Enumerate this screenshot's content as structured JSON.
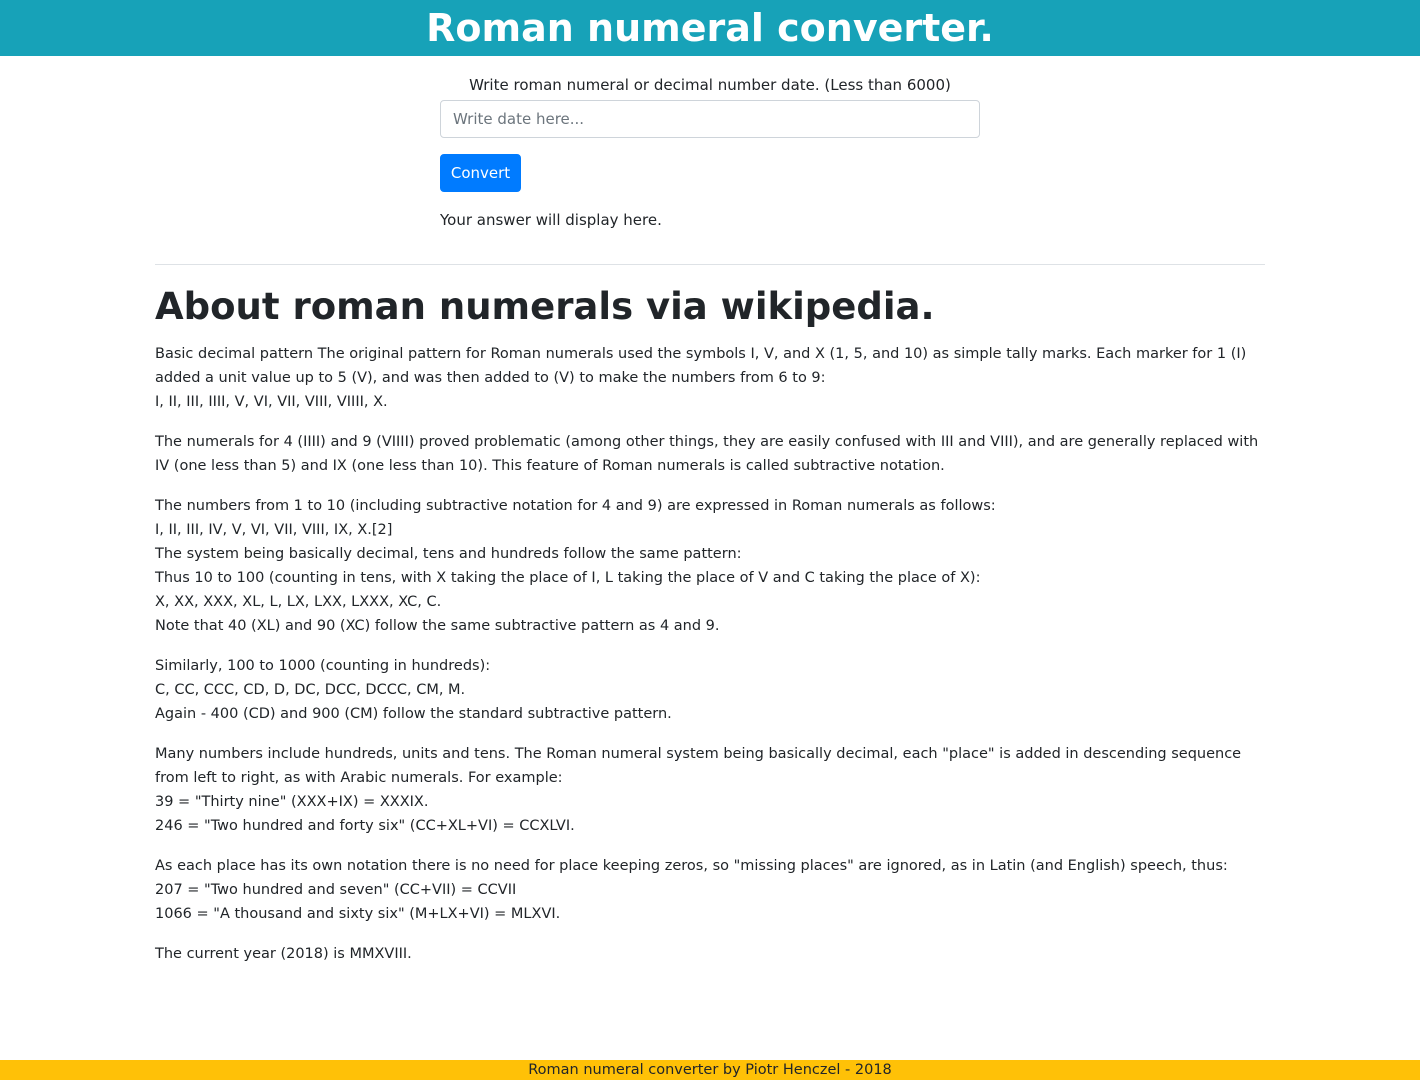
{
  "header": {
    "title": "Roman numeral converter."
  },
  "converter": {
    "label": "Write roman numeral or decimal number date. (Less than 6000)",
    "input_placeholder": "Write date here...",
    "input_value": "",
    "button_label": "Convert",
    "answer_text": "Your answer will display here."
  },
  "about": {
    "title": "About roman numerals via wikipedia.",
    "paragraphs": [
      [
        "Basic decimal pattern The original pattern for Roman numerals used the symbols I, V, and X (1, 5, and 10) as simple tally marks. Each marker for 1 (I) added a unit value up to 5 (V), and was then added to (V) to make the numbers from 6 to 9:",
        "I, II, III, IIII, V, VI, VII, VIII, VIIII, X."
      ],
      [
        "The numerals for 4 (IIII) and 9 (VIIII) proved problematic (among other things, they are easily confused with III and VIII), and are generally replaced with IV (one less than 5) and IX (one less than 10). This feature of Roman numerals is called subtractive notation."
      ],
      [
        "The numbers from 1 to 10 (including subtractive notation for 4 and 9) are expressed in Roman numerals as follows:",
        "I, II, III, IV, V, VI, VII, VIII, IX, X.[2]",
        "The system being basically decimal, tens and hundreds follow the same pattern:",
        "Thus 10 to 100 (counting in tens, with X taking the place of I, L taking the place of V and C taking the place of X):",
        "X, XX, XXX, XL, L, LX, LXX, LXXX, XC, C.",
        "Note that 40 (XL) and 90 (XC) follow the same subtractive pattern as 4 and 9."
      ],
      [
        "Similarly, 100 to 1000 (counting in hundreds):",
        "C, CC, CCC, CD, D, DC, DCC, DCCC, CM, M.",
        "Again - 400 (CD) and 900 (CM) follow the standard subtractive pattern."
      ],
      [
        "Many numbers include hundreds, units and tens. The Roman numeral system being basically decimal, each \"place\" is added in descending sequence from left to right, as with Arabic numerals. For example:",
        "39 = \"Thirty nine\" (XXX+IX) = XXXIX.",
        "246 = \"Two hundred and forty six\" (CC+XL+VI) = CCXLVI."
      ],
      [
        "As each place has its own notation there is no need for place keeping zeros, so \"missing places\" are ignored, as in Latin (and English) speech, thus:",
        "207 = \"Two hundred and seven\" (CC+VII) = CCVII",
        "1066 = \"A thousand and sixty six\" (M+LX+VI) = MLXVI."
      ],
      [
        "The current year (2018) is MMXVIII."
      ]
    ]
  },
  "footer": {
    "text": "Roman numeral converter by Piotr Henczel - 2018"
  },
  "colors": {
    "header_bg": "#17a2b8",
    "button_bg": "#007bff",
    "footer_bg": "#ffc107"
  }
}
